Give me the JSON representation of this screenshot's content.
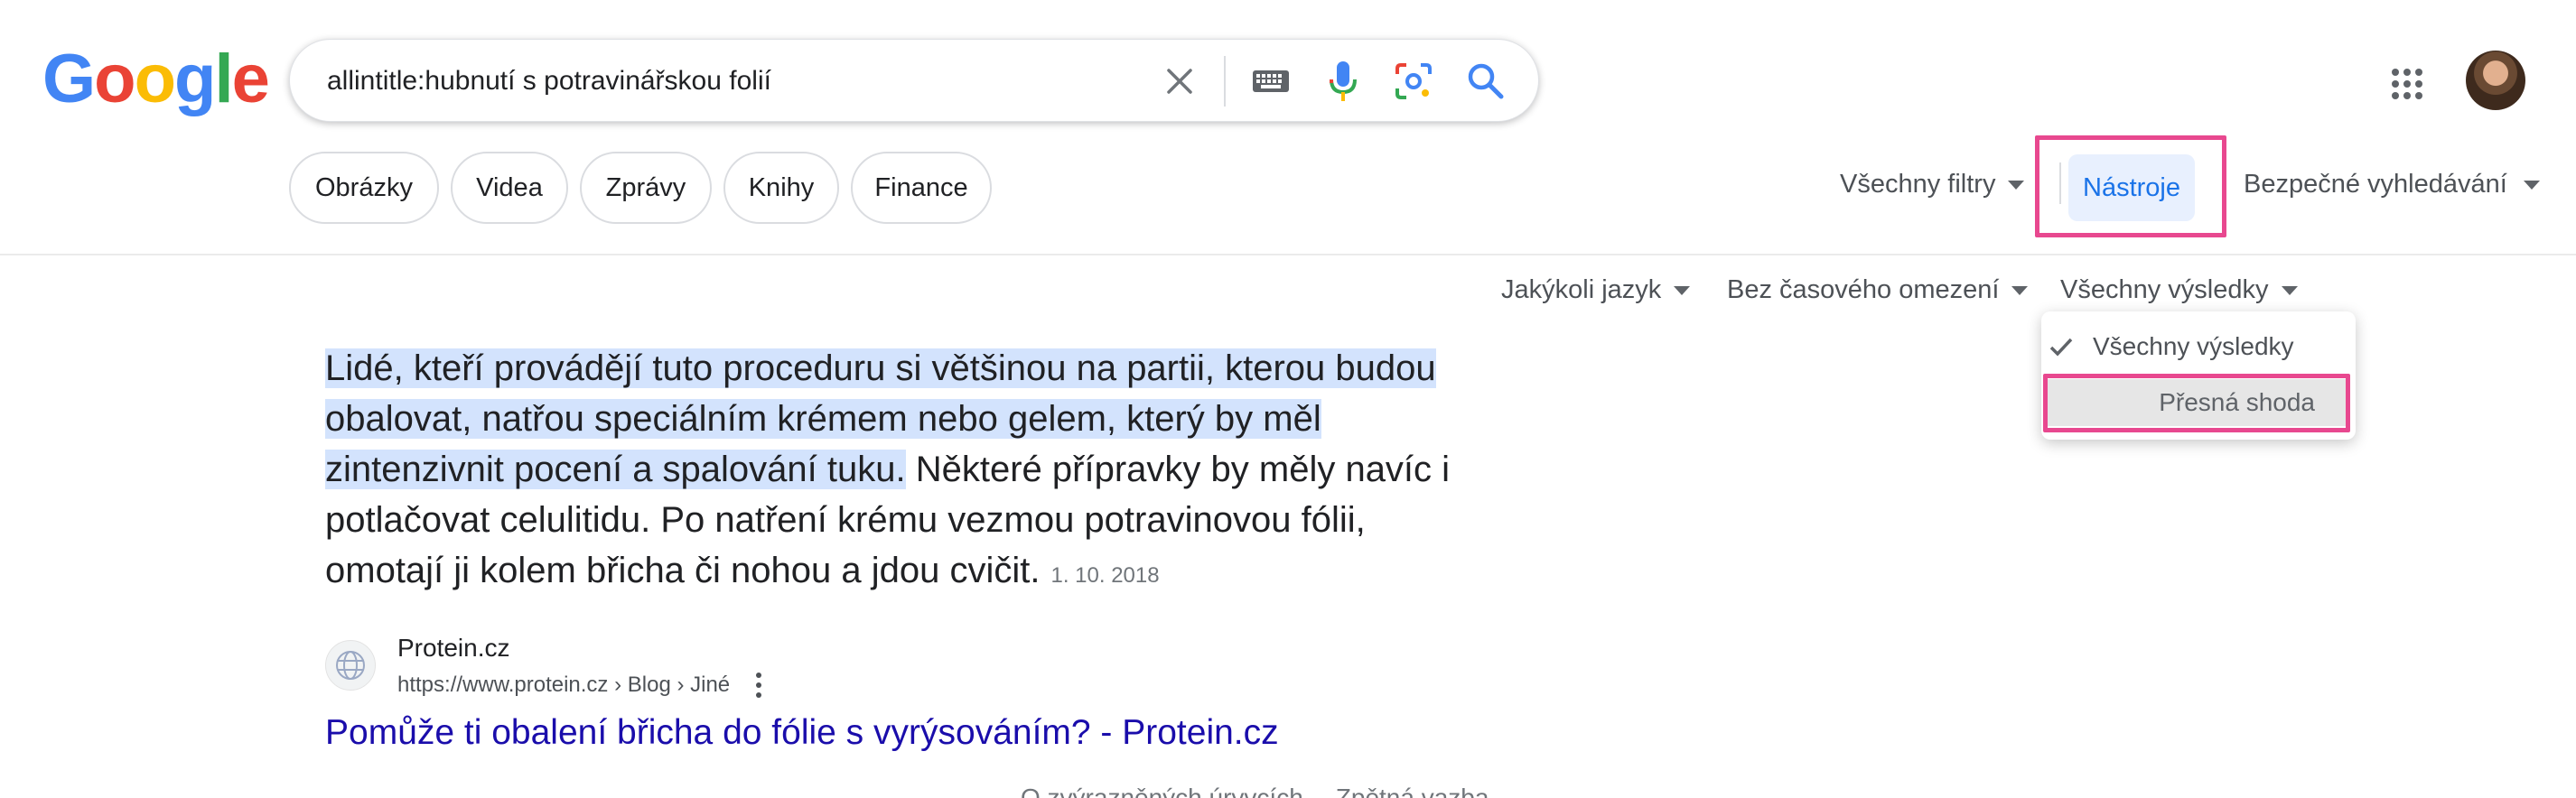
{
  "logo": {
    "letters": [
      "G",
      "o",
      "o",
      "g",
      "l",
      "e"
    ],
    "colors": [
      "#4285F4",
      "#EA4335",
      "#FBBC05",
      "#4285F4",
      "#34A853",
      "#EA4335"
    ]
  },
  "search": {
    "query": "allintitle:hubnutí s potravinářskou folií",
    "icons": [
      "close-icon",
      "keyboard-icon",
      "mic-icon",
      "lens-icon",
      "search-icon"
    ]
  },
  "header_right": {
    "icons": [
      "apps-grid-icon",
      "avatar"
    ]
  },
  "chips": [
    "Obrázky",
    "Videa",
    "Zprávy",
    "Knihy",
    "Finance"
  ],
  "toolbar": {
    "all_filters": "Všechny filtry",
    "tools": "Nástroje",
    "safe_search": "Bezpečné vyhledávání"
  },
  "tools_row": {
    "language": "Jakýkoli jazyk",
    "time": "Bez časového omezení",
    "results": "Všechny výsledky"
  },
  "results_menu": {
    "options": [
      "Všechny výsledky",
      "Přesná shoda"
    ],
    "selected": "Všechny výsledky",
    "hovered": "Přesná shoda"
  },
  "annotation": {
    "highlight_color": "#e8488f"
  },
  "snippet": {
    "highlighted": "Lidé, kteří provádějí tuto proceduru si většinou na partii, kterou budou obalovat, natřou speciálním krémem nebo gelem, který by měl zintenzivnit pocení a spalování tuku.",
    "rest": " Některé přípravky by měly navíc i potlačovat celulitidu. Po natření krému vezmou potravinovou fólii, omotají ji kolem břicha či nohou a jdou cvičit.",
    "date": "1. 10. 2018"
  },
  "result": {
    "site_name": "Protein.cz",
    "url": "https://www.protein.cz › Blog › Jiné",
    "title": "Pomůže ti obalení břicha do fólie s vyrýsováním? - Protein.cz"
  },
  "footer_row": {
    "about": "O zvýrazněných úryvcích",
    "feedback": "Zpětná vazba"
  }
}
